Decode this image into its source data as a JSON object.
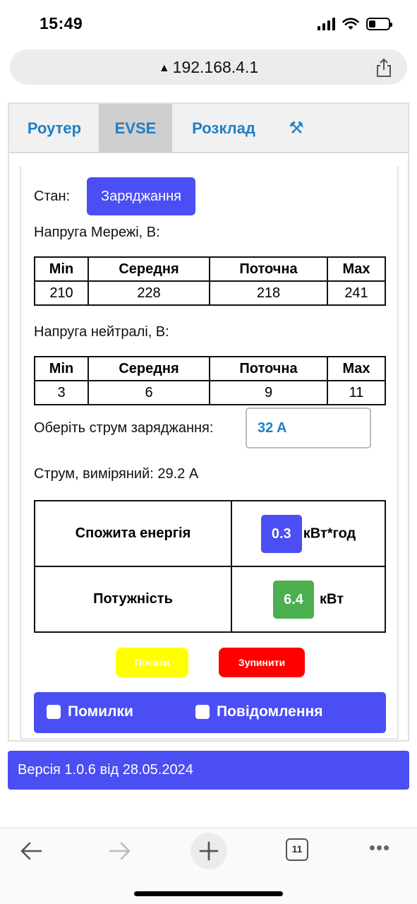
{
  "status_bar": {
    "time": "15:49"
  },
  "browser": {
    "url": "192.168.4.1",
    "tabs_count": "11"
  },
  "tabs": [
    {
      "label": "Роутер"
    },
    {
      "label": "EVSE"
    },
    {
      "label": "Розклад"
    }
  ],
  "active_tab": "EVSE",
  "state": {
    "label": "Стан:",
    "value": "Заряджання"
  },
  "grid_voltage": {
    "label": "Напруга Мережі, В:",
    "headers": [
      "Min",
      "Середня",
      "Поточна",
      "Max"
    ],
    "values": [
      "210",
      "228",
      "218",
      "241"
    ]
  },
  "neutral_voltage": {
    "label": "Напруга нейтралі, В:",
    "headers": [
      "Min",
      "Середня",
      "Поточна",
      "Max"
    ],
    "values": [
      "3",
      "6",
      "9",
      "11"
    ]
  },
  "charging_current": {
    "label": "Оберіть струм заряджання:",
    "selected": "32 A"
  },
  "measured_current": {
    "text": "Струм, виміряний: 29.2 A"
  },
  "energy": {
    "label": "Спожита енергія",
    "value": "0.3",
    "unit": "кВт*год",
    "color": "#4b4ef2"
  },
  "power": {
    "label": "Потужність",
    "value": "6.4",
    "unit": "кВт",
    "color": "#4caf50"
  },
  "buttons": {
    "start": "Почати",
    "stop": "Зупинити"
  },
  "toggles": {
    "errors": "Помилки",
    "messages": "Повідомлення"
  },
  "footer": {
    "version": "Версія 1.0.6 від 28.05.2024"
  },
  "colors": {
    "accent": "#4b4ef2",
    "link": "#1f7fc7",
    "start": "#ffff00",
    "stop": "#ff0000"
  }
}
